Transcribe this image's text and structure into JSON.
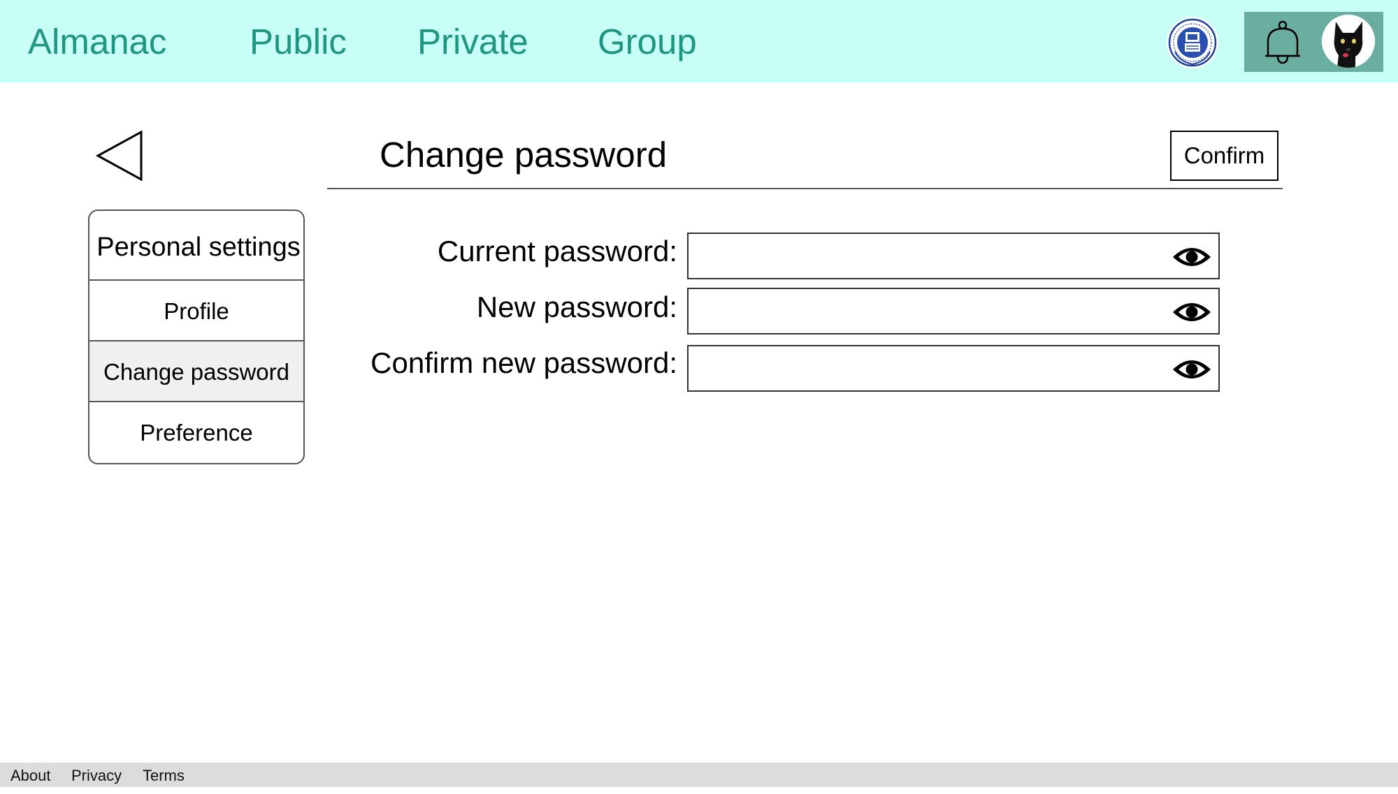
{
  "nav": {
    "brand": "Almanac",
    "links": [
      "Public",
      "Private",
      "Group"
    ]
  },
  "icons": {
    "org_logo": "university-seal-icon",
    "notifications": "bell-icon",
    "avatar": "black-dog-avatar",
    "back": "back-triangle-icon",
    "reveal": "eye-icon"
  },
  "colors": {
    "header_bg": "#c7fef6",
    "nav_text": "#1f9682",
    "user_box": "#6aaea1",
    "active_menu_bg": "#f0f0f0",
    "footer_bg": "#dcdcdc"
  },
  "page": {
    "title": "Change password",
    "confirm_label": "Confirm"
  },
  "menu": {
    "header": "Personal settings",
    "items": [
      "Profile",
      "Change password",
      "Preference"
    ],
    "active": "Change password"
  },
  "form": {
    "fields": [
      {
        "label": "Current password:",
        "value": ""
      },
      {
        "label": "New password:",
        "value": ""
      },
      {
        "label": "Confirm new password:",
        "value": ""
      }
    ]
  },
  "footer": {
    "links": [
      "About",
      "Privacy",
      "Terms"
    ]
  }
}
